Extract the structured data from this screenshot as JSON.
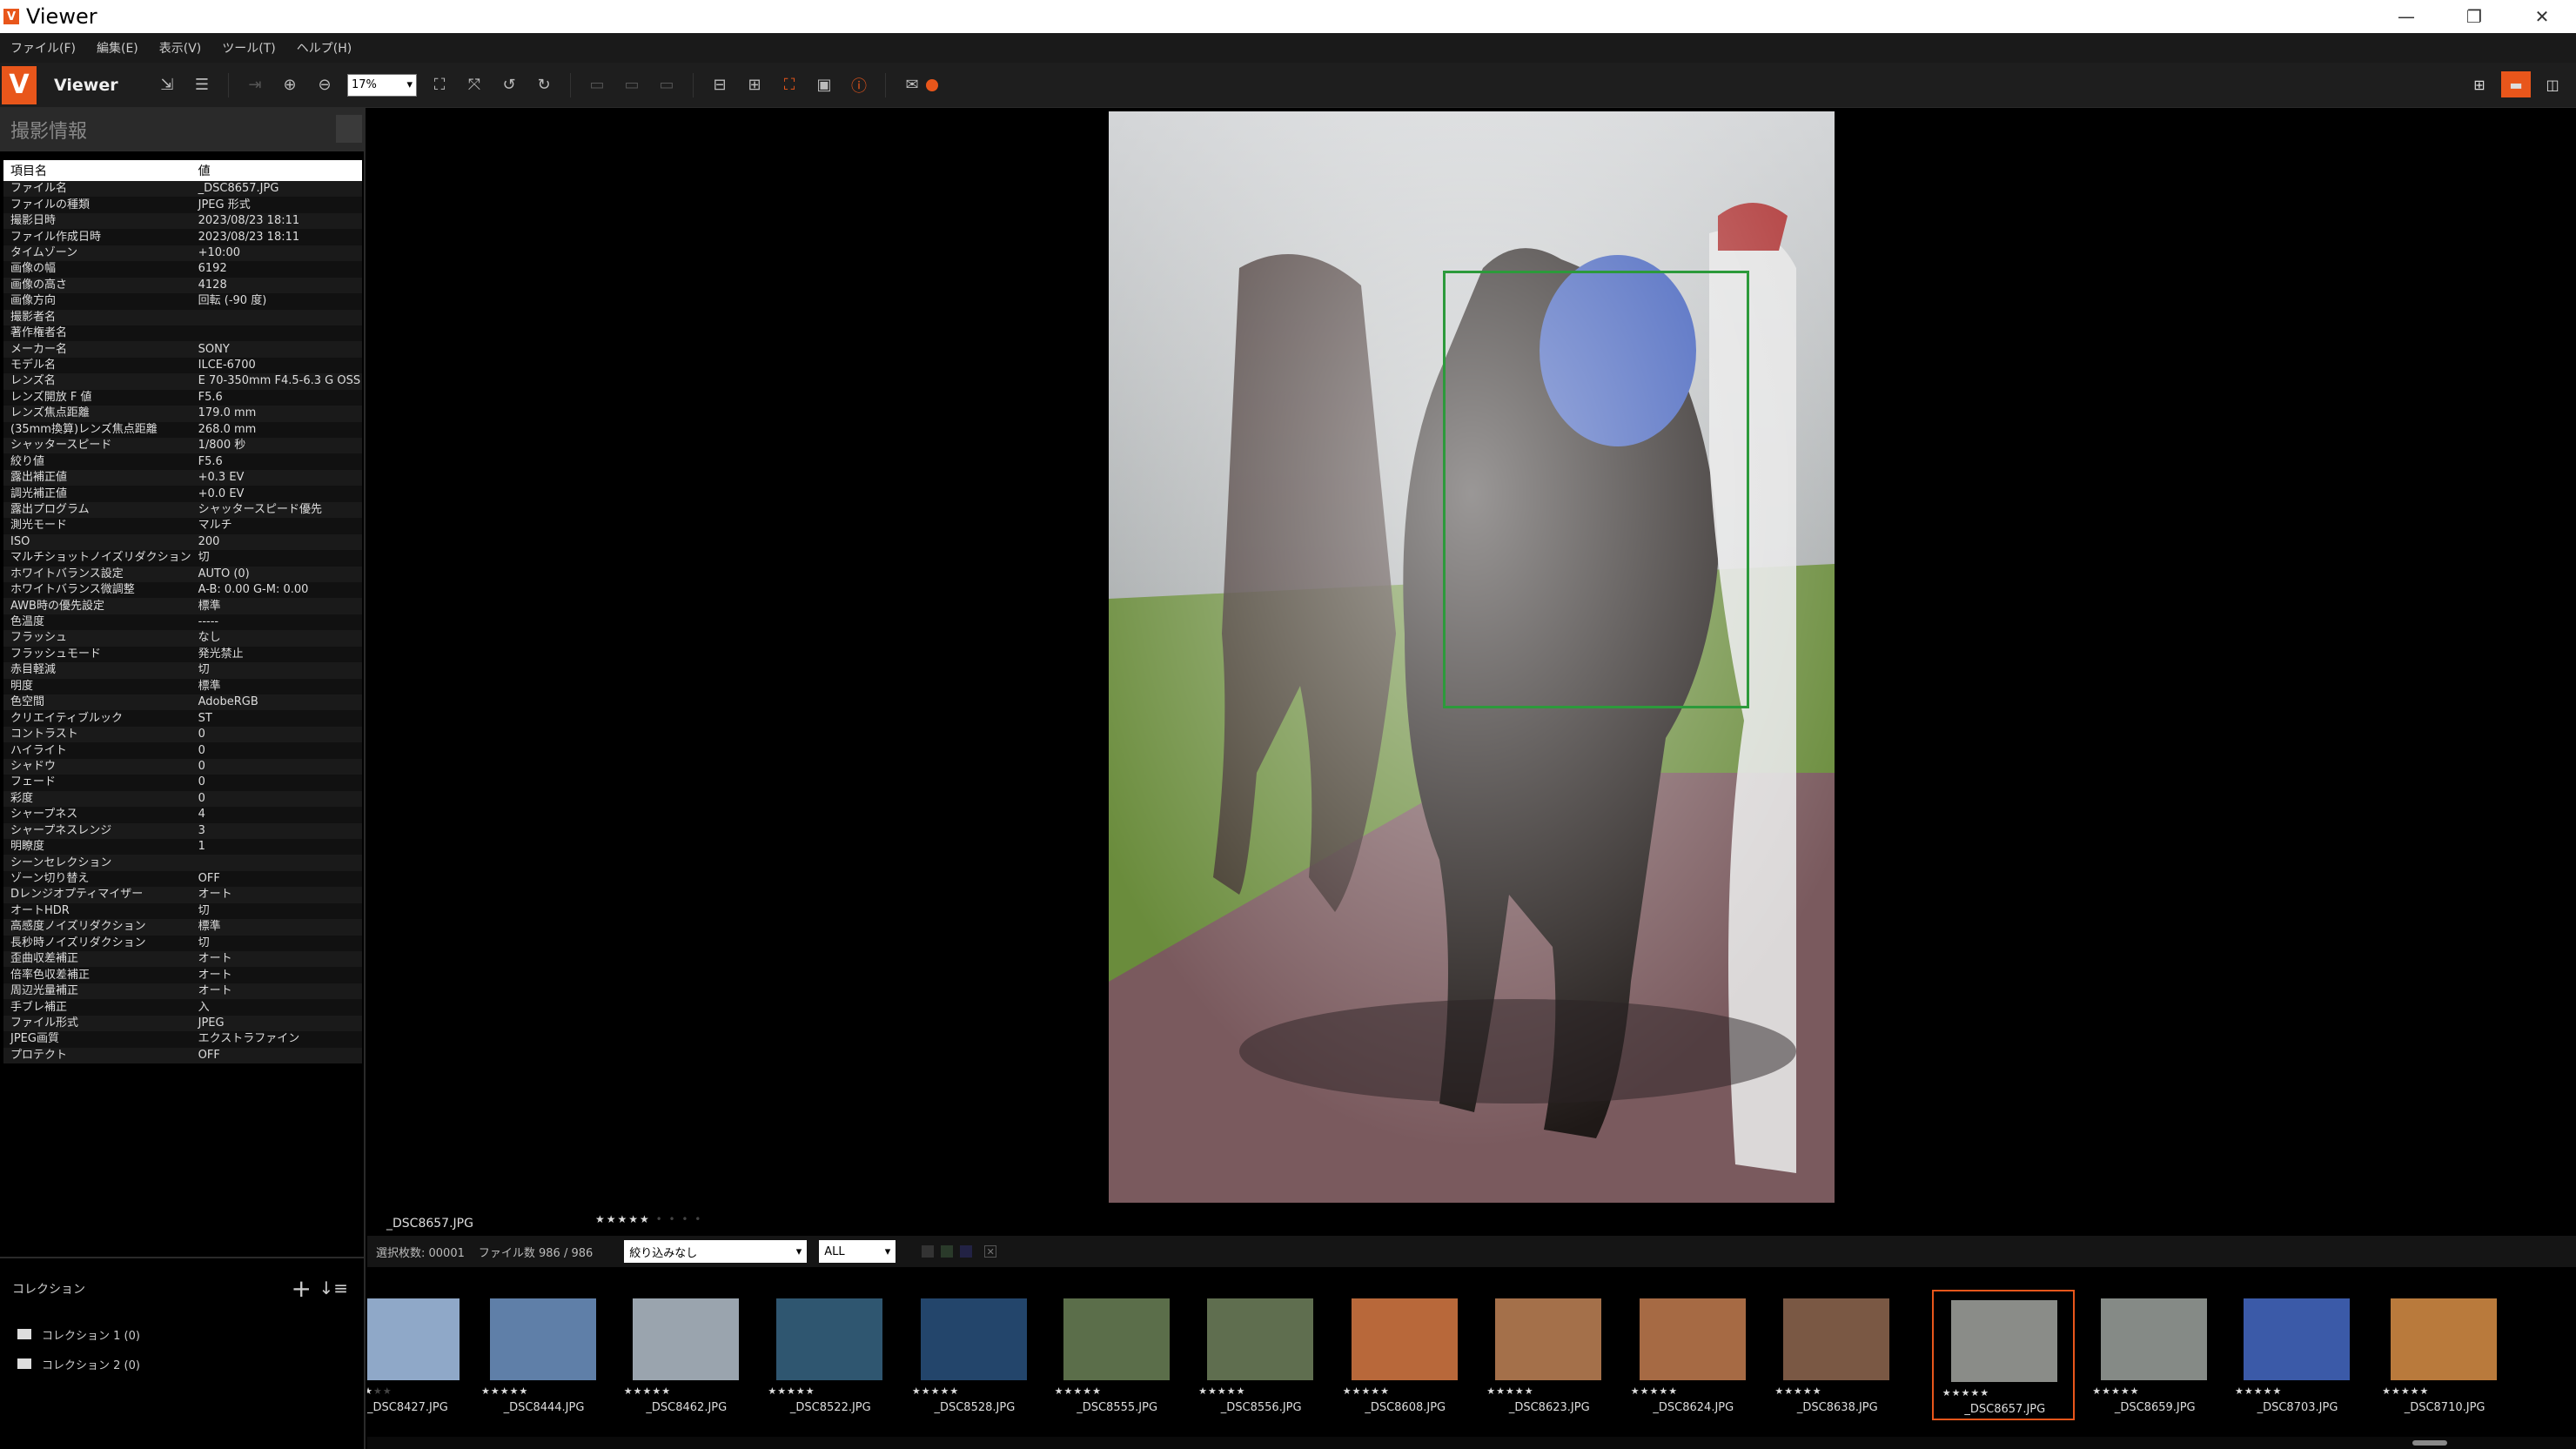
{
  "window": {
    "title": "Viewer",
    "icon_letter": "V",
    "controls": [
      "—",
      "❐",
      "✕"
    ]
  },
  "menu": [
    "ファイル(F)",
    "編集(E)",
    "表示(V)",
    "ツール(T)",
    "ヘルプ(H)"
  ],
  "toolbar": {
    "mode": "Viewer",
    "zoom": "17%"
  },
  "info_panel": {
    "title": "撮影情報",
    "headers": {
      "key": "項目名",
      "value": "値"
    },
    "rows": [
      [
        "ファイル名",
        "_DSC8657.JPG"
      ],
      [
        "ファイルの種類",
        "JPEG 形式"
      ],
      [
        "撮影日時",
        "2023/08/23 18:11"
      ],
      [
        "ファイル作成日時",
        "2023/08/23 18:11"
      ],
      [
        "タイムゾーン",
        "+10:00"
      ],
      [
        "画像の幅",
        "6192"
      ],
      [
        "画像の高さ",
        "4128"
      ],
      [
        "画像方向",
        "回転 (-90 度)"
      ],
      [
        "撮影者名",
        ""
      ],
      [
        "著作権者名",
        ""
      ],
      [
        "メーカー名",
        "SONY"
      ],
      [
        "モデル名",
        "ILCE-6700"
      ],
      [
        "レンズ名",
        "E 70-350mm F4.5-6.3 G OSS"
      ],
      [
        "レンズ開放 F 値",
        "F5.6"
      ],
      [
        "レンズ焦点距離",
        "179.0 mm"
      ],
      [
        "(35mm換算)レンズ焦点距離",
        "268.0 mm"
      ],
      [
        "シャッタースピード",
        "1/800 秒"
      ],
      [
        "絞り値",
        "F5.6"
      ],
      [
        "露出補正値",
        "+0.3 EV"
      ],
      [
        "調光補正値",
        "+0.0 EV"
      ],
      [
        "露出プログラム",
        "シャッタースピード優先"
      ],
      [
        "測光モード",
        "マルチ"
      ],
      [
        "ISO",
        "200"
      ],
      [
        "マルチショットノイズリダクション",
        "切"
      ],
      [
        "ホワイトバランス設定",
        "AUTO (0)"
      ],
      [
        "ホワイトバランス微調整",
        "A-B: 0.00 G-M: 0.00"
      ],
      [
        "AWB時の優先設定",
        "標準"
      ],
      [
        "色温度",
        "-----"
      ],
      [
        "フラッシュ",
        "なし"
      ],
      [
        "フラッシュモード",
        "発光禁止"
      ],
      [
        "赤目軽減",
        "切"
      ],
      [
        "明度",
        "標準"
      ],
      [
        "色空間",
        "AdobeRGB"
      ],
      [
        "クリエイティブルック",
        "ST"
      ],
      [
        "コントラスト",
        "0"
      ],
      [
        "ハイライト",
        "0"
      ],
      [
        "シャドウ",
        "0"
      ],
      [
        "フェード",
        "0"
      ],
      [
        "彩度",
        "0"
      ],
      [
        "シャープネス",
        "4"
      ],
      [
        "シャープネスレンジ",
        "3"
      ],
      [
        "明瞭度",
        "1"
      ],
      [
        "シーンセレクション",
        ""
      ],
      [
        "ゾーン切り替え",
        "OFF"
      ],
      [
        "Dレンジオプティマイザー",
        "オート"
      ],
      [
        "オートHDR",
        "切"
      ],
      [
        "高感度ノイズリダクション",
        "標準"
      ],
      [
        "長秒時ノイズリダクション",
        "切"
      ],
      [
        "歪曲収差補正",
        "オート"
      ],
      [
        "倍率色収差補正",
        "オート"
      ],
      [
        "周辺光量補正",
        "オート"
      ],
      [
        "手ブレ補正",
        "入"
      ],
      [
        "ファイル形式",
        "JPEG"
      ],
      [
        "JPEG画質",
        "エクストラファイン"
      ],
      [
        "プロテクト",
        "OFF"
      ]
    ]
  },
  "collections": {
    "title": "コレクション",
    "items": [
      "コレクション 1 (0)",
      "コレクション 2 (0)"
    ]
  },
  "main": {
    "filename": "_DSC8657.JPG",
    "rating_filled": "★★★★★",
    "rating_dim": "• • • •"
  },
  "filmbar": {
    "selected_count": "選択枚数: 00001",
    "file_count": "ファイル数 986 / 986",
    "filter": "絞り込みなし",
    "filter2": "ALL"
  },
  "thumbnails": [
    {
      "name": "_DSC8427.JPG",
      "stars": "★★★",
      "dim": "★★",
      "bg": "#8fa8c8"
    },
    {
      "name": "_DSC8444.JPG",
      "stars": "★★★★★",
      "dim": "",
      "bg": "#5f7fa8"
    },
    {
      "name": "_DSC8462.JPG",
      "stars": "★★★★★",
      "dim": "",
      "bg": "#9aa4ae"
    },
    {
      "name": "_DSC8522.JPG",
      "stars": "★★★★★",
      "dim": "",
      "bg": "#2f5670"
    },
    {
      "name": "_DSC8528.JPG",
      "stars": "★★★★★",
      "dim": "",
      "bg": "#23456b"
    },
    {
      "name": "_DSC8555.JPG",
      "stars": "★★★★★",
      "dim": "",
      "bg": "#5b6e4a"
    },
    {
      "name": "_DSC8556.JPG",
      "stars": "★★★★★",
      "dim": "",
      "bg": "#5f6e4f"
    },
    {
      "name": "_DSC8608.JPG",
      "stars": "★★★★★",
      "dim": "",
      "bg": "#b8683a"
    },
    {
      "name": "_DSC8623.JPG",
      "stars": "★★★★★",
      "dim": "",
      "bg": "#a4704a"
    },
    {
      "name": "_DSC8624.JPG",
      "stars": "★★★★★",
      "dim": "",
      "bg": "#a66a44"
    },
    {
      "name": "_DSC8638.JPG",
      "stars": "★★★★★",
      "dim": "",
      "bg": "#7a5844"
    },
    {
      "name": "_DSC8657.JPG",
      "stars": "★★★★★",
      "dim": "",
      "bg": "#8a8c88"
    },
    {
      "name": "_DSC8659.JPG",
      "stars": "★★★★★",
      "dim": "",
      "bg": "#858a86"
    },
    {
      "name": "_DSC8703.JPG",
      "stars": "★★★★★",
      "dim": "",
      "bg": "#3b5aa8"
    },
    {
      "name": "_DSC8710.JPG",
      "stars": "★★★★★",
      "dim": "",
      "bg": "#b97a3c"
    }
  ],
  "colors": {
    "accent": "#e8561b",
    "focus": "#2c9a3b"
  }
}
